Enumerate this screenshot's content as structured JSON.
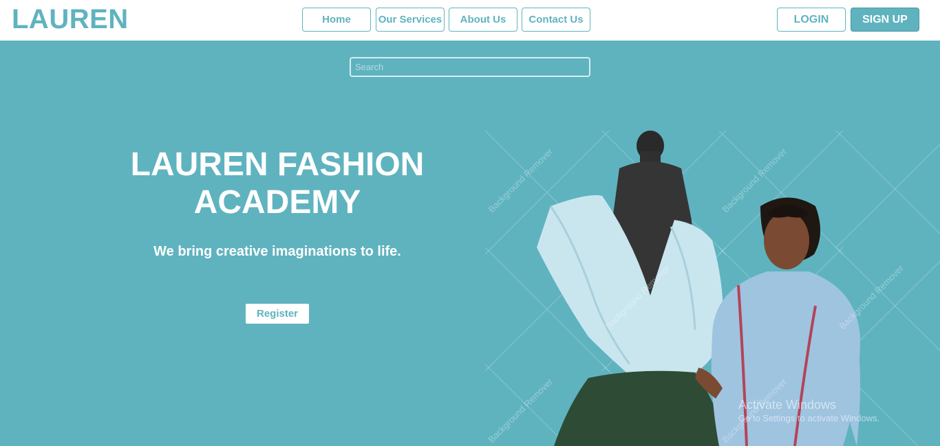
{
  "brand": {
    "logo": "LAUREN"
  },
  "nav": {
    "items": [
      {
        "label": "Home"
      },
      {
        "label": "Our Services"
      },
      {
        "label": "About Us"
      },
      {
        "label": "Contact Us"
      }
    ]
  },
  "auth": {
    "login_label": "LOGIN",
    "signup_label": "SIGN UP"
  },
  "search": {
    "placeholder": "Search",
    "value": ""
  },
  "hero": {
    "title_line1": "LAUREN FASHION",
    "title_line2": "ACADEMY",
    "subtitle": "We bring creative imaginations to life.",
    "register_label": "Register"
  },
  "watermark": {
    "overlay_text": "Background Remover",
    "activate_title": "Activate Windows",
    "activate_sub": "Go to Settings to activate Windows."
  },
  "colors": {
    "accent": "#5fb3bf",
    "background": "#5fb3bf",
    "navbar": "#ffffff",
    "text_light": "#ffffff"
  }
}
